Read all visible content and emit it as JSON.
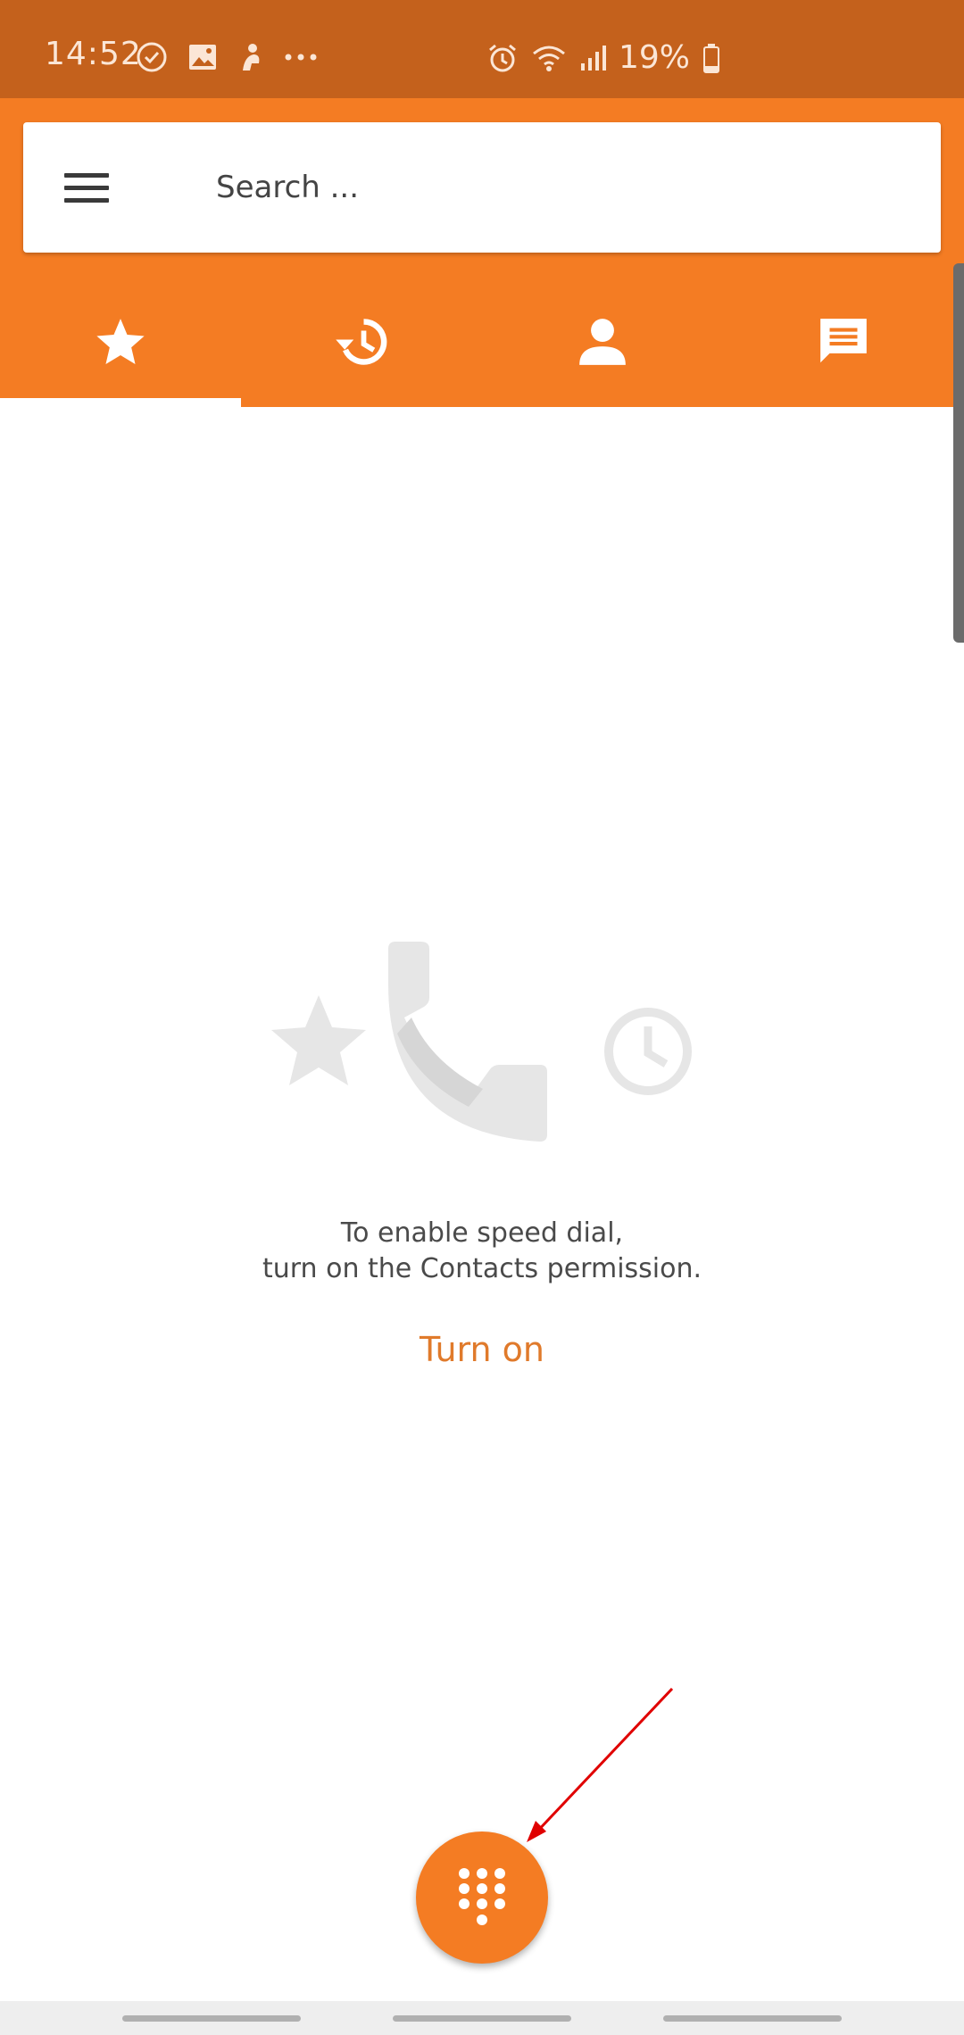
{
  "status_bar": {
    "time": "14:52",
    "battery": "19%",
    "icons": [
      "check-circle-icon",
      "image-icon",
      "app-icon",
      "more-icon",
      "alarm-icon",
      "wifi-icon",
      "signal-icon",
      "battery-icon"
    ]
  },
  "search": {
    "placeholder": "Search ..."
  },
  "tabs": [
    {
      "icon": "star-icon",
      "selected": true
    },
    {
      "icon": "history-icon",
      "selected": false
    },
    {
      "icon": "person-icon",
      "selected": false
    },
    {
      "icon": "message-icon",
      "selected": false
    }
  ],
  "empty_state": {
    "line1": "To enable speed dial,",
    "line2": "turn on the Contacts permission.",
    "action": "Turn on"
  },
  "fab": {
    "icon": "dialpad-icon"
  },
  "colors": {
    "accent": "#f47c23",
    "status_bar": "#c4611c",
    "action_text": "#e07a2b",
    "annotation": "#e00000"
  }
}
